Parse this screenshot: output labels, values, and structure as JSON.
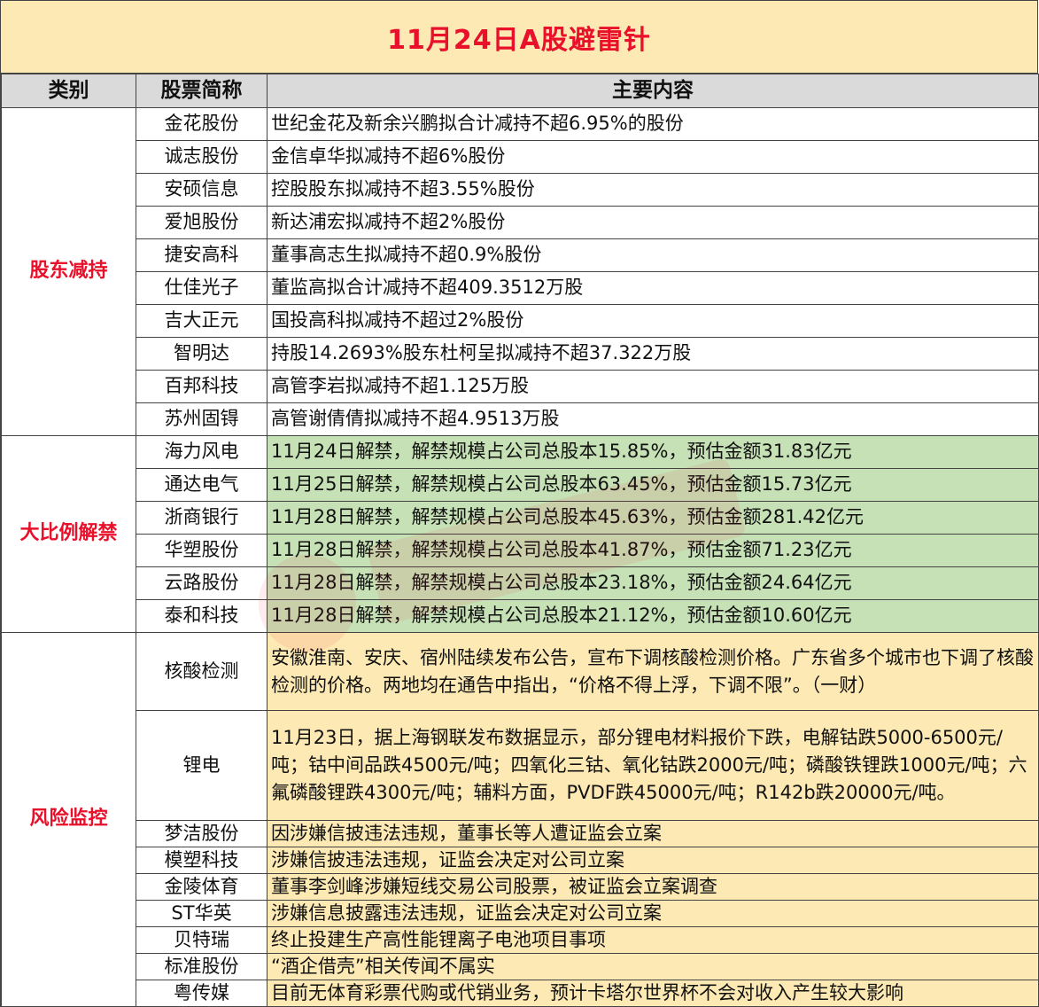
{
  "title": "11月24日A股避雷针",
  "headers": [
    "类别",
    "股票简称",
    "主要内容"
  ],
  "sections": [
    {
      "category": "股东减持",
      "rows": [
        {
          "name": "金花股份",
          "content": "世纪金花及新余兴鹏拟合计减持不超6.95%的股份"
        },
        {
          "name": "诚志股份",
          "content": "金信卓华拟减持不超6%股份"
        },
        {
          "name": "安硕信息",
          "content": "控股股东拟减持不超3.55%股份"
        },
        {
          "name": "爱旭股份",
          "content": "新达浦宏拟减持不超2%股份"
        },
        {
          "name": "捷安高科",
          "content": "董事高志生拟减持不超0.9%股份"
        },
        {
          "name": "仕佳光子",
          "content": "董监高拟合计减持不超409.3512万股"
        },
        {
          "name": "吉大正元",
          "content": "国投高科拟减持不超过2%股份"
        },
        {
          "name": "智明达",
          "content": "持股14.2693%股东杜柯呈拟减持不超37.322万股"
        },
        {
          "name": "百邦科技",
          "content": "高管李岩拟减持不超1.125万股"
        },
        {
          "name": "苏州固锝",
          "content": "高管谢倩倩拟减持不超4.9513万股"
        }
      ]
    },
    {
      "category": "大比例解禁",
      "rows": [
        {
          "name": "海力风电",
          "content": "11月24日解禁，解禁规模占公司总股本15.85%，预估金额31.83亿元"
        },
        {
          "name": "通达电气",
          "content": "11月25日解禁，解禁规模占公司总股本63.45%，预估金额15.73亿元"
        },
        {
          "name": "浙商银行",
          "content": "11月28日解禁，解禁规模占公司总股本45.63%，预估金额281.42亿元"
        },
        {
          "name": "华塑股份",
          "content": "11月28日解禁，解禁规模占公司总股本41.87%，预估金额71.23亿元"
        },
        {
          "name": "云路股份",
          "content": "11月28日解禁，解禁规模占公司总股本23.18%，预估金额24.64亿元"
        },
        {
          "name": "泰和科技",
          "content": "11月28日解禁，解禁规模占公司总股本21.12%，预估金额10.60亿元"
        }
      ]
    },
    {
      "category": "风险监控",
      "rows": [
        {
          "name": "核酸检测",
          "content": "安徽淮南、安庆、宿州陆续发布公告，宣布下调核酸检测价格。广东省多个城市也下调了核酸检测的价格。两地均在通告中指出，“价格不得上浮，下调不限”。（一财）"
        },
        {
          "name": "锂电",
          "content": "11月23日，据上海钢联发布数据显示，部分锂电材料报价下跌，电解钴跌5000-6500元/吨；钴中间品跌4500元/吨；四氧化三钴、氧化钴跌2000元/吨；磷酸铁锂跌1000元/吨；六氟磷酸锂跌4300元/吨；辅料方面，PVDF跌45000元/吨；R142b跌20000元/吨。"
        },
        {
          "name": "梦洁股份",
          "content": "因涉嫌信披违法违规，董事长等人遭证监会立案"
        },
        {
          "name": "模塑科技",
          "content": "涉嫌信披违法违规，证监会决定对公司立案"
        },
        {
          "name": "金陵体育",
          "content": "董事李剑峰涉嫌短线交易公司股票，被证监会立案调查"
        },
        {
          "name": "ST华英",
          "content": "涉嫌信息披露违法违规，证监会决定对公司立案"
        },
        {
          "name": "贝特瑞",
          "content": "终止投建生产高性能锂离子电池项目事项"
        },
        {
          "name": "标准股份",
          "content": "“酒企借壳”相关传闻不属实"
        },
        {
          "name": "粤传媒",
          "content": "目前无体育彩票代购或代销业务，预计卡塔尔世界杯不会对收入产生较大影响"
        }
      ]
    }
  ],
  "colors": {
    "title_bg": "#fde9b3",
    "title_text": "#e8102a",
    "header_bg": "#dadada",
    "green_row": "#c6e1b5",
    "yellow_row": "#fde9b3"
  }
}
